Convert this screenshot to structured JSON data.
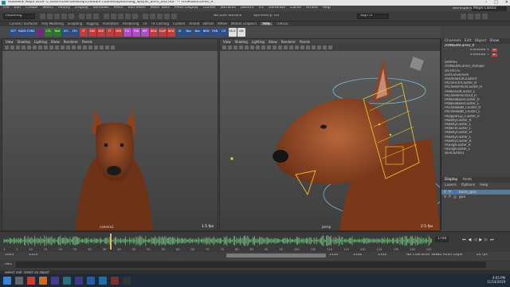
{
  "window": {
    "title": "Autodesk Maya 2019: C:\\Users\\User\\Desktop\\Creature Course\\layouts\\dog_lipsync_anim_002.ma* --- ctrlMouthCorner_R",
    "controls": [
      "–",
      "□",
      "✕"
    ]
  },
  "menubar": {
    "items": [
      "File",
      "Edit",
      "Create",
      "Select",
      "Modify",
      "Display",
      "Windows",
      "Mesh",
      "Edit Mesh",
      "Mesh Tools",
      "Mesh Display",
      "Curves",
      "Surfaces",
      "Deform",
      "UV",
      "Generate",
      "Cache",
      "Arnold",
      "Help"
    ],
    "workspace_label": "Workspace :",
    "workspace_value": "Maya Classic"
  },
  "statusline": {
    "mode": "Modeling",
    "no_live_surface": "No Live Surface",
    "symmetry": "Symmetry: Off",
    "sign_in": "Sign In"
  },
  "shelf": {
    "tabs": [
      "Curves / Surfaces",
      "Poly Modeling",
      "Sculpting",
      "Rigging",
      "Animation",
      "Rendering",
      "FX",
      "FX Caching",
      "Custom",
      "Arnold",
      "Bifrost",
      "MASH",
      "Motion Graphics",
      "XGen_Interactive_Groom",
      "XGen",
      "TURTLE"
    ],
    "active_tab": "MINE",
    "buttons": [
      "RCT",
      "AUDIO",
      "CONS",
      "",
      "CTL",
      "Rad",
      "LFC",
      "LTH",
      "ST",
      "EBS",
      "BSR",
      "FT",
      "BSR",
      "TGL",
      "TRB",
      "BPI",
      "NEW",
      "SLAP",
      "NEW",
      "IK",
      "Non",
      "Non",
      "NEW",
      "EVN",
      "CO",
      "FACE",
      "USE"
    ]
  },
  "viewport_left": {
    "menus": [
      "View",
      "Shading",
      "Lighting",
      "Show",
      "Renderer",
      "Panels"
    ],
    "camera": "camera1",
    "fps": "1.5 fps"
  },
  "viewport_right": {
    "menus": [
      "View",
      "Shading",
      "Lighting",
      "Show",
      "Renderer",
      "Panels"
    ],
    "camera": "persp",
    "fps": "2.5 fps"
  },
  "channelbox": {
    "tabs": [
      "Channels",
      "Edit",
      "Object",
      "Show"
    ],
    "selected": "ctrlMouthCorner_R",
    "attrs": [
      {
        "name": "Translate X",
        "value": "0"
      },
      {
        "name": "Translate Y",
        "value": "0"
      }
    ],
    "shapes_header": "SHAPES",
    "shape": "ctrlMouthCorner_RShape",
    "outputs_header": "OUTPUTS",
    "outputs": [
      "unitConversion",
      "FKSmileOutClusterTr",
      "FKChinCtrlCluster_H",
      "FKCheekPinchCluster_H",
      "FKNose3dCluster_L",
      "FKCheekPinchOut_R",
      "FKNoseBaseCluster_R",
      "FKNoseBaseCluster_L",
      "FKCheekbBt_Cluster_R",
      "FKCheekbBt_Cluster_L",
      "FKUpperLip_Cluster_R",
      "FKBellyCluster_R",
      "FKBellyCluster_L",
      "FKNeckCluster_L",
      "FKBellyCluster_H",
      "FKBellyCluster_L",
      "FKBellyCluster_R",
      "FKSnglCluster_R",
      "FKSnglCluster_L",
      "skinCluster1"
    ]
  },
  "layers": {
    "tabs": [
      "Display",
      "Anim"
    ],
    "menus": [
      "Layers",
      "Options",
      "Help"
    ],
    "items": [
      {
        "v": "V",
        "p": "P",
        "name": "bone_geo"
      },
      {
        "v": "V",
        "p": "P",
        "name": "geo"
      }
    ]
  },
  "timeslider": {
    "ticks": [
      "1",
      "5",
      "10",
      "15",
      "20",
      "25",
      "30",
      "35",
      "40",
      "45",
      "50",
      "55",
      "60",
      "65",
      "70",
      "75",
      "80",
      "85",
      "90",
      "95",
      "100",
      "105",
      "110",
      "115",
      "120",
      "125",
      "130",
      "135",
      "140"
    ],
    "current_frame": "1746"
  },
  "range": {
    "start": "1001",
    "inner_start": "1101",
    "inner_end": "1330",
    "end_a": "1330",
    "end_b": "1330",
    "character_set": "No Character Set",
    "anim_layer": "No Anim Layer",
    "fps": "24 fps"
  },
  "mel": {
    "label": "MEL"
  },
  "helpline": {
    "text": "Select Tool: select an object"
  },
  "taskbar": {
    "time": "4:05 PM",
    "date": "11/14/2019"
  }
}
